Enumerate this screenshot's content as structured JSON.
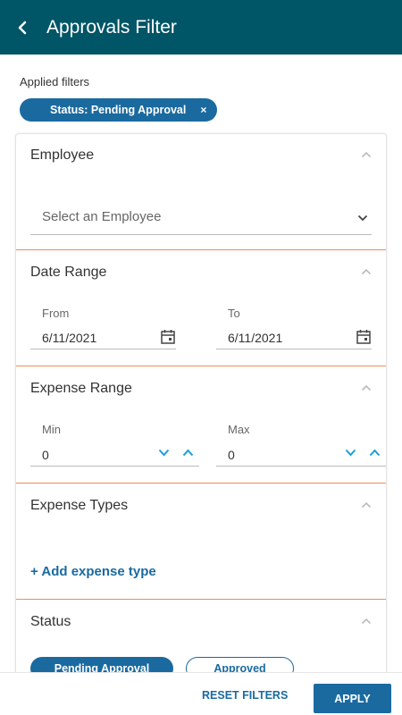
{
  "header": {
    "title": "Approvals Filter",
    "back_icon": "chevron-left-icon"
  },
  "applied": {
    "label": "Applied filters",
    "chip": "Status: Pending Approval",
    "remove": "×"
  },
  "employee": {
    "title": "Employee",
    "placeholder": "Select an Employee"
  },
  "date_range": {
    "title": "Date Range",
    "from_label": "From",
    "from_value": "6/11/2021",
    "to_label": "To",
    "to_value": "6/11/2021"
  },
  "expense_range": {
    "title": "Expense Range",
    "min_label": "Min",
    "min_value": "0",
    "max_label": "Max",
    "max_value": "0"
  },
  "expense_types": {
    "title": "Expense Types",
    "add_label": "+ Add expense type"
  },
  "status": {
    "title": "Status",
    "options": [
      {
        "label": "Pending Approval",
        "selected": true
      },
      {
        "label": "Approved",
        "selected": false
      }
    ]
  },
  "footer": {
    "reset_label": "RESET FILTERS",
    "apply_label": "APPLY"
  },
  "colors": {
    "header": "#005566",
    "accent": "#1a6aa0",
    "divider": "#f08c5a",
    "stepper": "#1aa0d8"
  }
}
